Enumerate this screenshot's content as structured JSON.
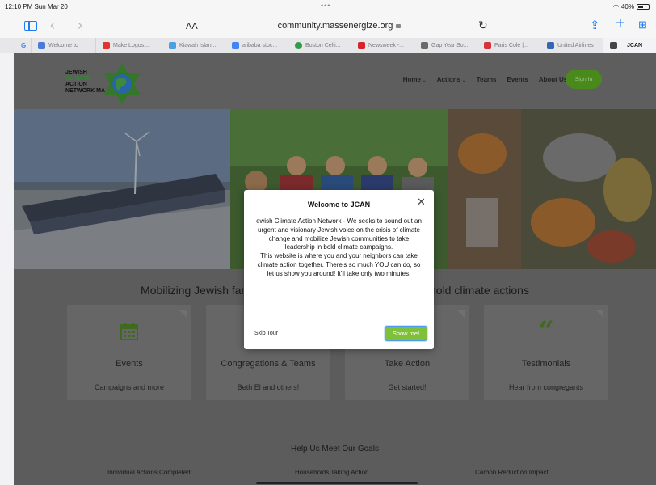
{
  "status_bar": {
    "time": "12:10 PM  Sun Mar 20",
    "battery": "40%"
  },
  "toolbar": {
    "text_size_label": "AA",
    "url": "community.massenergize.org"
  },
  "tabs": [
    {
      "label": "",
      "color": "#4a7bdc"
    },
    {
      "label": "Welcome tc",
      "color": "#4a7bdc"
    },
    {
      "label": "Make Logos,...",
      "color": "#e0342f"
    },
    {
      "label": "Kiawah Islan...",
      "color": "#4aa0e0"
    },
    {
      "label": "alibaba stoc...",
      "color": "#4285f4"
    },
    {
      "label": "Boston Celti...",
      "color": "#2e9e4a"
    },
    {
      "label": "Newsweek -...",
      "color": "#d8232a"
    },
    {
      "label": "Gap Year So...",
      "color": "#6a6a6a"
    },
    {
      "label": "Paris Cole |...",
      "color": "#d8323a"
    },
    {
      "label": "United Airlines",
      "color": "#3466b5"
    },
    {
      "label": "JCAN",
      "color": "#444444"
    }
  ],
  "site": {
    "logo_lines": [
      "JEWISH",
      "CLIMATE",
      "ACTION",
      "NETWORK MA"
    ],
    "nav": {
      "home": "Home",
      "actions": "Actions",
      "teams": "Teams",
      "events": "Events",
      "about": "About Us"
    },
    "sign_in": "Sign In",
    "mission": "Mobilizing Jewish families and communities to take household climate actions",
    "cards": [
      {
        "title": "Events",
        "subtitle": "Campaigns and more",
        "icon": "calendar-icon"
      },
      {
        "title": "Congregations & Teams",
        "subtitle": "Beth El and others!",
        "icon": "people-icon"
      },
      {
        "title": "Take Action",
        "subtitle": "Get started!",
        "icon": "action-icon"
      },
      {
        "title": "Testimonials",
        "subtitle": "Hear from congregants",
        "icon": "quote-icon"
      }
    ],
    "goals_heading": "Help Us Meet Our Goals",
    "stats": [
      "Individual Actions Completed",
      "Households Taking Action",
      "Carbon Reduction Impact"
    ],
    "accent_color": "#5a9a2a"
  },
  "modal": {
    "title": "Welcome to JCAN",
    "body_1": "ewish Climate Action Network - We seeks to sound out an urgent and visionary Jewish voice on the crisis of climate change and mobilize Jewish communities to take leadership in bold climate campaigns.",
    "body_2": "This website is where you and your neighbors can take climate action together. There's so much YOU can do, so let us show you around! It'll take only two minutes.",
    "skip_label": "Skip Tour",
    "confirm_label": "Show me!"
  }
}
